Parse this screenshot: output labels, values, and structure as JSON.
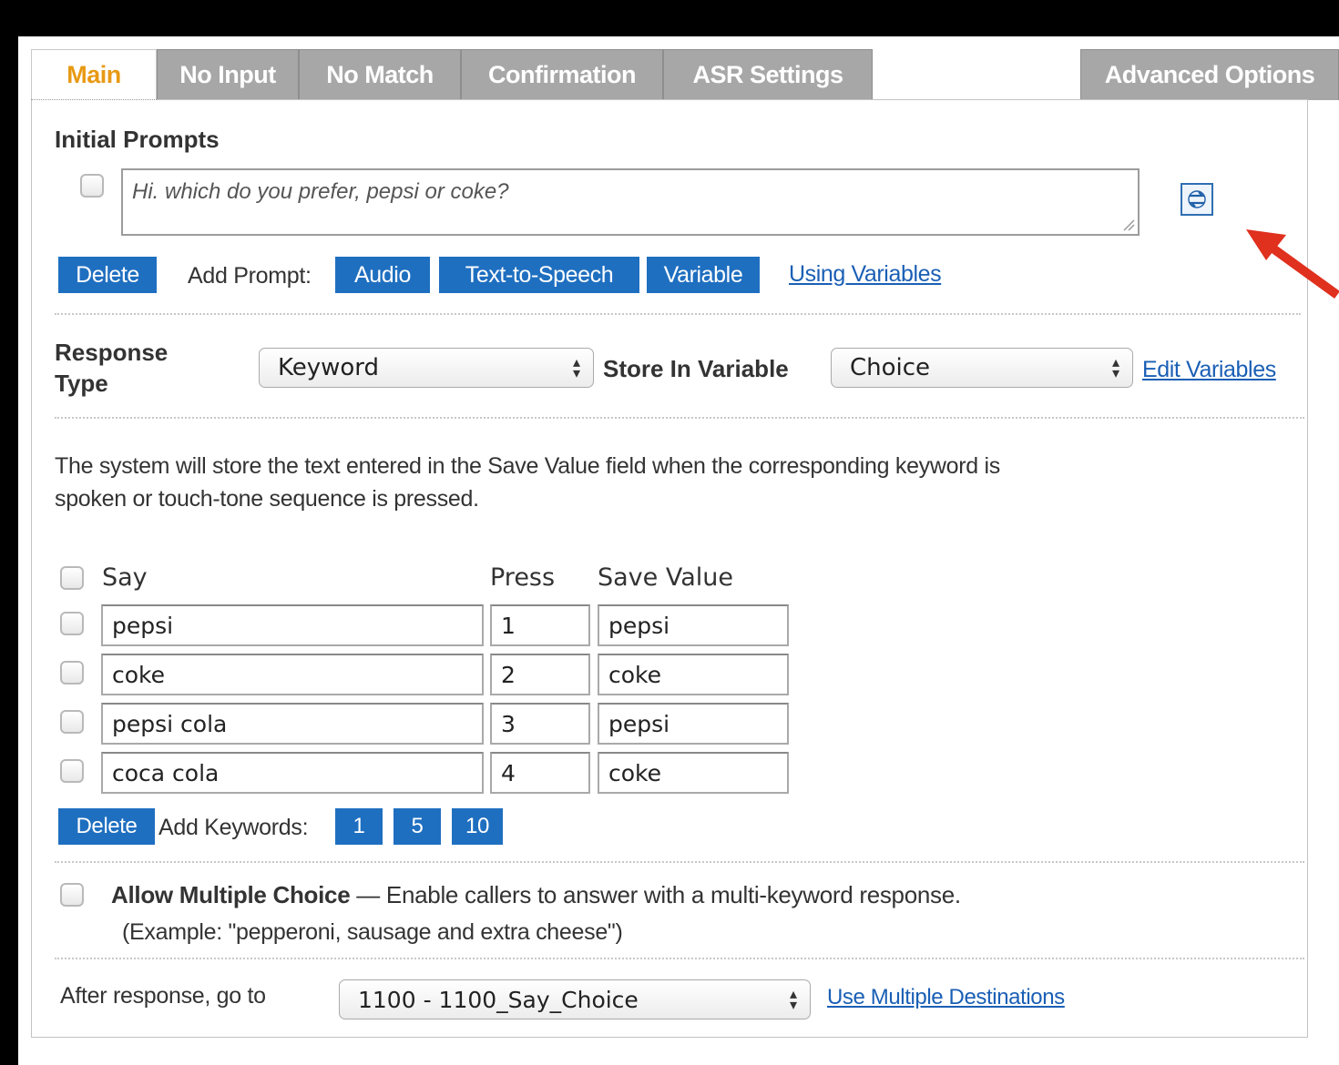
{
  "tabs": [
    {
      "label": "Main",
      "active": true
    },
    {
      "label": "No Input",
      "active": false
    },
    {
      "label": "No Match",
      "active": false
    },
    {
      "label": "Confirmation",
      "active": false
    },
    {
      "label": "ASR Settings",
      "active": false
    },
    {
      "label": "Advanced Options",
      "active": false
    }
  ],
  "initial_prompts": {
    "heading": "Initial Prompts",
    "prompt_text": "Hi. which do you prefer, pepsi or coke?",
    "delete_label": "Delete",
    "add_prompt_label": "Add Prompt:",
    "audio_label": "Audio",
    "tts_label": "Text-to-Speech",
    "variable_label": "Variable",
    "using_variables_link": "Using Variables",
    "swap_icon": "swap-icon"
  },
  "response": {
    "type_label_line1": "Response",
    "type_label_line2": "Type",
    "type_value": "Keyword",
    "store_label": "Store In Variable",
    "store_value": "Choice",
    "edit_variables_link": "Edit Variables"
  },
  "description": {
    "line1": "The system will store the text entered in the Save Value field when the corresponding keyword is",
    "line2": "spoken or touch-tone sequence is pressed."
  },
  "keywords": {
    "columns": {
      "say": "Say",
      "press": "Press",
      "save": "Save Value"
    },
    "rows": [
      {
        "say": "pepsi",
        "press": "1",
        "save": "pepsi"
      },
      {
        "say": "coke",
        "press": "2",
        "save": "coke"
      },
      {
        "say": "pepsi cola",
        "press": "3",
        "save": "pepsi"
      },
      {
        "say": "coca cola",
        "press": "4",
        "save": "coke"
      }
    ],
    "delete_label": "Delete",
    "add_keywords_label": "Add Keywords:",
    "add_options": [
      "1",
      "5",
      "10"
    ]
  },
  "multiple_choice": {
    "title": "Allow Multiple Choice",
    "desc": " — Enable callers to answer with a multi-keyword response.",
    "example": "(Example: \"pepperoni, sausage and extra cheese\")"
  },
  "after_response": {
    "label": "After response, go to",
    "value": "1100 - 1100_Say_Choice",
    "link": "Use Multiple Destinations"
  },
  "colors": {
    "accent_tab": "#e89a14",
    "button_blue": "#1f6fc0",
    "link": "#1a5fb5",
    "arrow": "#e0301e"
  }
}
